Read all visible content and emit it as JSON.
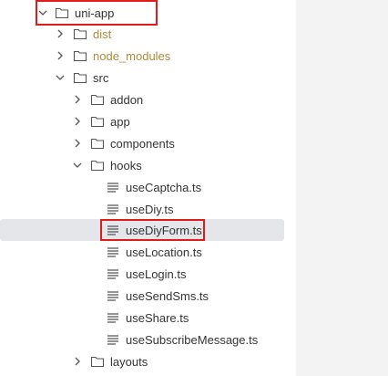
{
  "tree": {
    "root": {
      "label": "uni-app",
      "expanded": true
    },
    "items": [
      {
        "label": "dist",
        "kind": "folder",
        "expanded": false,
        "ignored": true
      },
      {
        "label": "node_modules",
        "kind": "folder",
        "expanded": false,
        "ignored": true
      },
      {
        "label": "src",
        "kind": "folder",
        "expanded": true
      },
      {
        "label": "addon",
        "kind": "folder",
        "expanded": false
      },
      {
        "label": "app",
        "kind": "folder",
        "expanded": false
      },
      {
        "label": "components",
        "kind": "folder",
        "expanded": false
      },
      {
        "label": "hooks",
        "kind": "folder",
        "expanded": true
      },
      {
        "label": "useCaptcha.ts",
        "kind": "file"
      },
      {
        "label": "useDiy.ts",
        "kind": "file"
      },
      {
        "label": "useDiyForm.ts",
        "kind": "file",
        "selected": true
      },
      {
        "label": "useLocation.ts",
        "kind": "file"
      },
      {
        "label": "useLogin.ts",
        "kind": "file"
      },
      {
        "label": "useSendSms.ts",
        "kind": "file"
      },
      {
        "label": "useShare.ts",
        "kind": "file"
      },
      {
        "label": "useSubscribeMessage.ts",
        "kind": "file"
      },
      {
        "label": "layouts",
        "kind": "folder",
        "expanded": false
      }
    ]
  },
  "colors": {
    "highlight": "#e01b1b",
    "ignored_text": "#b08a3a",
    "selected_bg": "#e4e6ea",
    "side_panel": "#f3f3f3"
  }
}
